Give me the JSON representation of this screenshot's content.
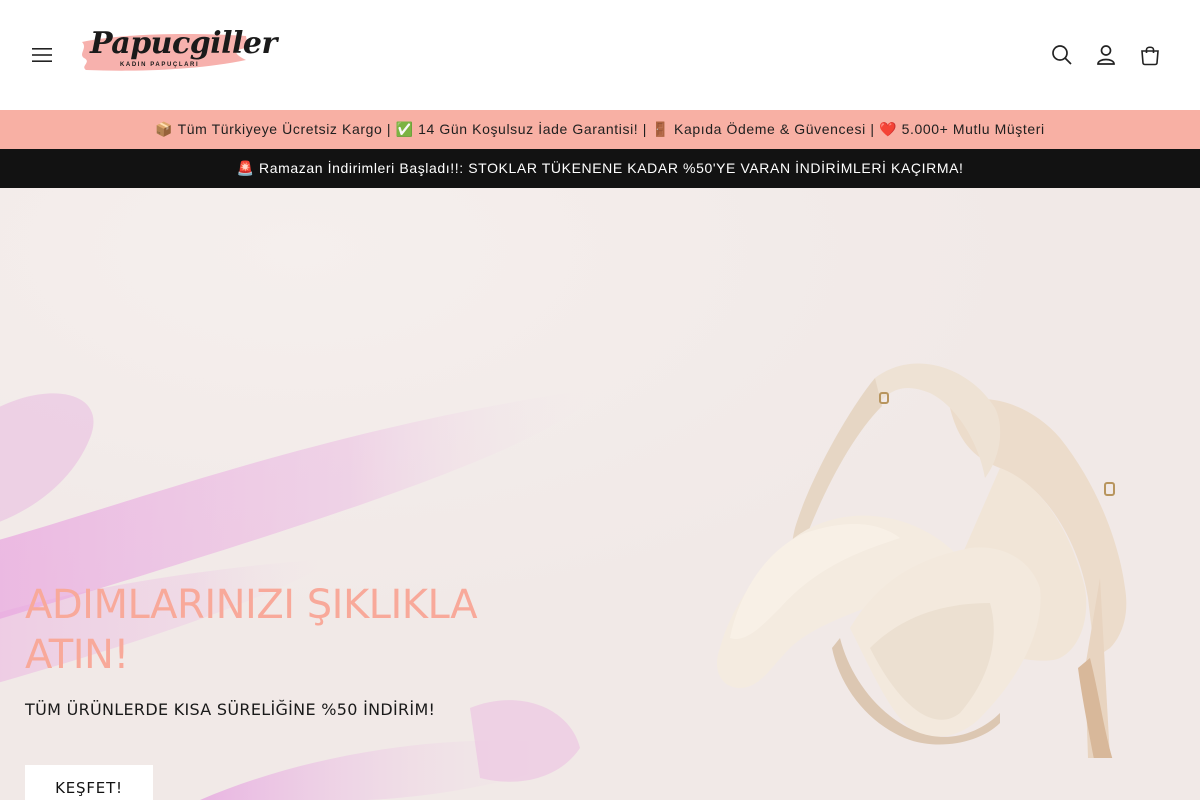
{
  "header": {
    "logo_text": "Papucgiller",
    "logo_tagline": "KADIN PAPUÇLARI",
    "colors": {
      "logo_brush": "#f6a9a4"
    }
  },
  "announcement_top": {
    "text": "📦 Tüm Türkiyeye Ücretsiz Kargo | ✅ 14 Gün Koşulsuz İade Garantisi! | 🚪 Kapıda Ödeme & Güvencesi | ❤️ 5.000+ Mutlu Müşteri",
    "bg_color": "#f8b0a4"
  },
  "announcement_bottom": {
    "text": "🚨 Ramazan İndirimleri Başladı!!: STOKLAR TÜKENENE KADAR %50'YE VARAN İNDİRİMLERİ KAÇIRMA!",
    "bg_color": "#121212"
  },
  "hero": {
    "title": "ADIMLARINIZI ŞIKLIKLA ATIN!",
    "subtitle": "TÜM ÜRÜNLERDE KISA SÜRELİĞİNE %50 İNDİRİM!",
    "button_label": "KEŞFET!",
    "colors": {
      "title": "#f8a99a",
      "background": "#f3ecea",
      "brush": "#e9a6e0"
    }
  },
  "icons": [
    "hamburger-menu-icon",
    "search-icon",
    "account-icon",
    "cart-icon"
  ]
}
